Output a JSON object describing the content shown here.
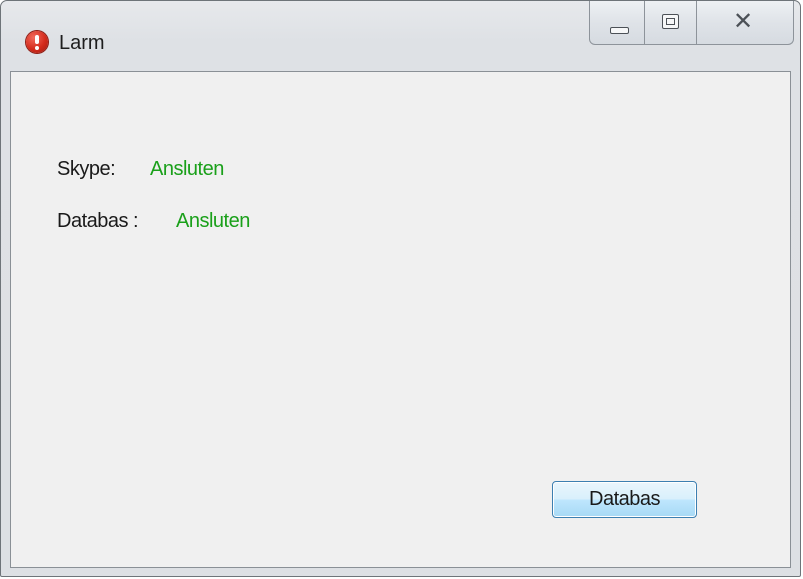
{
  "window": {
    "title": "Larm",
    "icon": "error-icon",
    "controls": {
      "minimize": "minimize-icon",
      "maximize": "maximize-icon",
      "close": "close-icon",
      "close_glyph": "✕"
    }
  },
  "status": {
    "skype_label": "Skype:",
    "skype_value": "Ansluten",
    "database_label": "Databas :",
    "database_value": "Ansluten",
    "connected_color": "#1aa01a"
  },
  "actions": {
    "database_button_label": "Databas"
  }
}
